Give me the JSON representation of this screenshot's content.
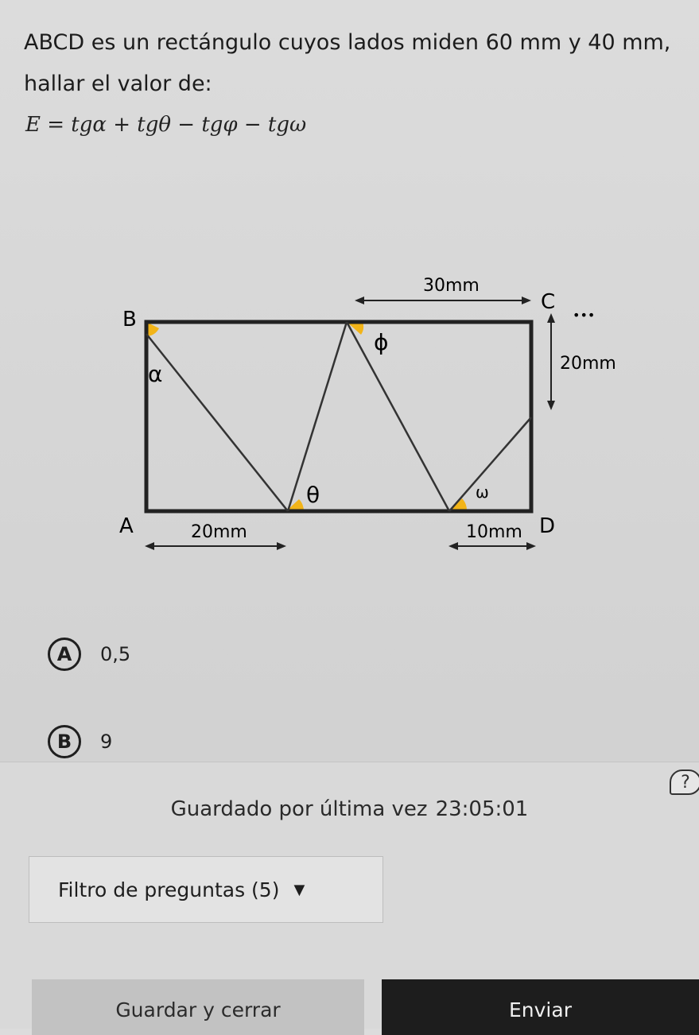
{
  "question": {
    "text": "ABCD es un rectángulo cuyos lados miden 60 mm y 40 mm, hallar el valor de:",
    "formula": "E = tgα + tgθ − tgφ − tgω"
  },
  "figure": {
    "labels": {
      "vertex_b": "B",
      "vertex_c": "C",
      "vertex_a": "A",
      "vertex_d": "D",
      "dots": "•••",
      "alpha": "α",
      "theta": "θ",
      "phi": "ϕ",
      "omega": "ω",
      "dim_top": "30mm",
      "dim_right": "20mm",
      "dim_bottom_left": "20mm",
      "dim_bottom_right": "10mm"
    },
    "colors": {
      "angle_fill": "#f2b418",
      "lines": "#222222"
    }
  },
  "options": [
    {
      "letter": "A",
      "value": "0,5"
    },
    {
      "letter": "B",
      "value": "9"
    }
  ],
  "footer": {
    "help_icon": "?",
    "saved_label": "Guardado por última vez",
    "saved_time": "23:05:01",
    "filter_label": "Filtro de preguntas (5)",
    "filter_caret": "▼",
    "save_close_label": "Guardar y cerrar",
    "submit_label": "Enviar"
  }
}
